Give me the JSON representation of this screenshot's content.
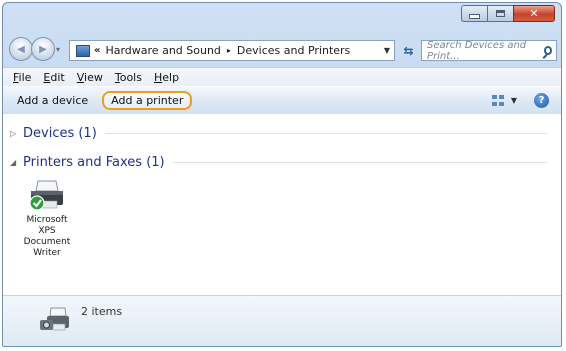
{
  "window": {
    "caption_minimize": "",
    "caption_maximize": "",
    "caption_close": "✕"
  },
  "address": {
    "chevron": "«",
    "crumbs": [
      "Hardware and Sound",
      "Devices and Printers"
    ],
    "separator": "▸"
  },
  "search": {
    "placeholder": "Search Devices and Print..."
  },
  "menu": {
    "file": {
      "mnemonic": "F",
      "rest": "ile"
    },
    "edit": {
      "mnemonic": "E",
      "rest": "dit"
    },
    "view": {
      "mnemonic": "V",
      "rest": "iew"
    },
    "tools": {
      "mnemonic": "T",
      "rest": "ools"
    },
    "help": {
      "mnemonic": "H",
      "rest": "elp"
    }
  },
  "commands": {
    "add_device": "Add a device",
    "add_printer": "Add a printer",
    "highlight_color": "#f39a1f"
  },
  "groups": {
    "devices": {
      "label": "Devices (1)",
      "expanded": false
    },
    "printers": {
      "label": "Printers and Faxes (1)",
      "expanded": true
    }
  },
  "printer": {
    "name_lines": [
      "Microsoft",
      "XPS",
      "Document",
      "Writer"
    ],
    "icon": "printer-default-icon"
  },
  "details": {
    "count": "2 items",
    "icon": "printer-camera-icon"
  }
}
